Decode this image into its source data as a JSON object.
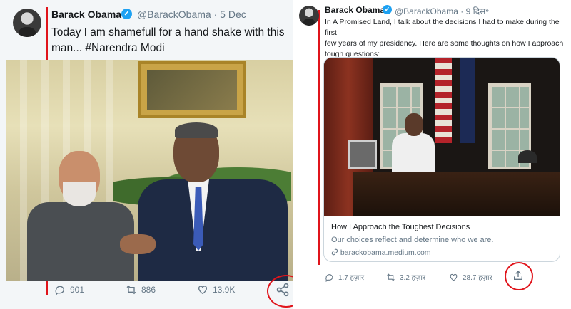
{
  "left_tweet": {
    "name": "Barack Obama",
    "handle": "@BarackObama",
    "separator": "·",
    "date": "5 Dec",
    "text_line1": "Today I am shamefull for a hand shake with this",
    "text_line2": "man... #Narendra Modi",
    "replies": "901",
    "retweets": "886",
    "likes": "13.9K"
  },
  "right_tweet": {
    "name": "Barack Obama",
    "handle": "@BarackObama",
    "separator": "·",
    "date": "9 दिस॰",
    "text_line1": "In A Promised Land, I talk about the decisions I had to make during the first",
    "text_line2": "few years of my presidency. Here are some thoughts on how I approach",
    "text_line3": "tough questions:",
    "card_title": "How I Approach the Toughest Decisions",
    "card_description": "Our choices reflect and determine who we are.",
    "card_link": "barackobama.medium.com",
    "replies": "1.7 हज़ार",
    "retweets": "3.2 हज़ार",
    "likes": "28.7 हज़ार"
  },
  "colors": {
    "annotation_red": "#e0141b",
    "verified_blue": "#1da1f2",
    "muted_text": "#657786"
  },
  "icons": [
    "avatar",
    "verified-badge-icon",
    "reply-icon",
    "retweet-icon",
    "like-icon",
    "share-icon",
    "link-icon"
  ]
}
